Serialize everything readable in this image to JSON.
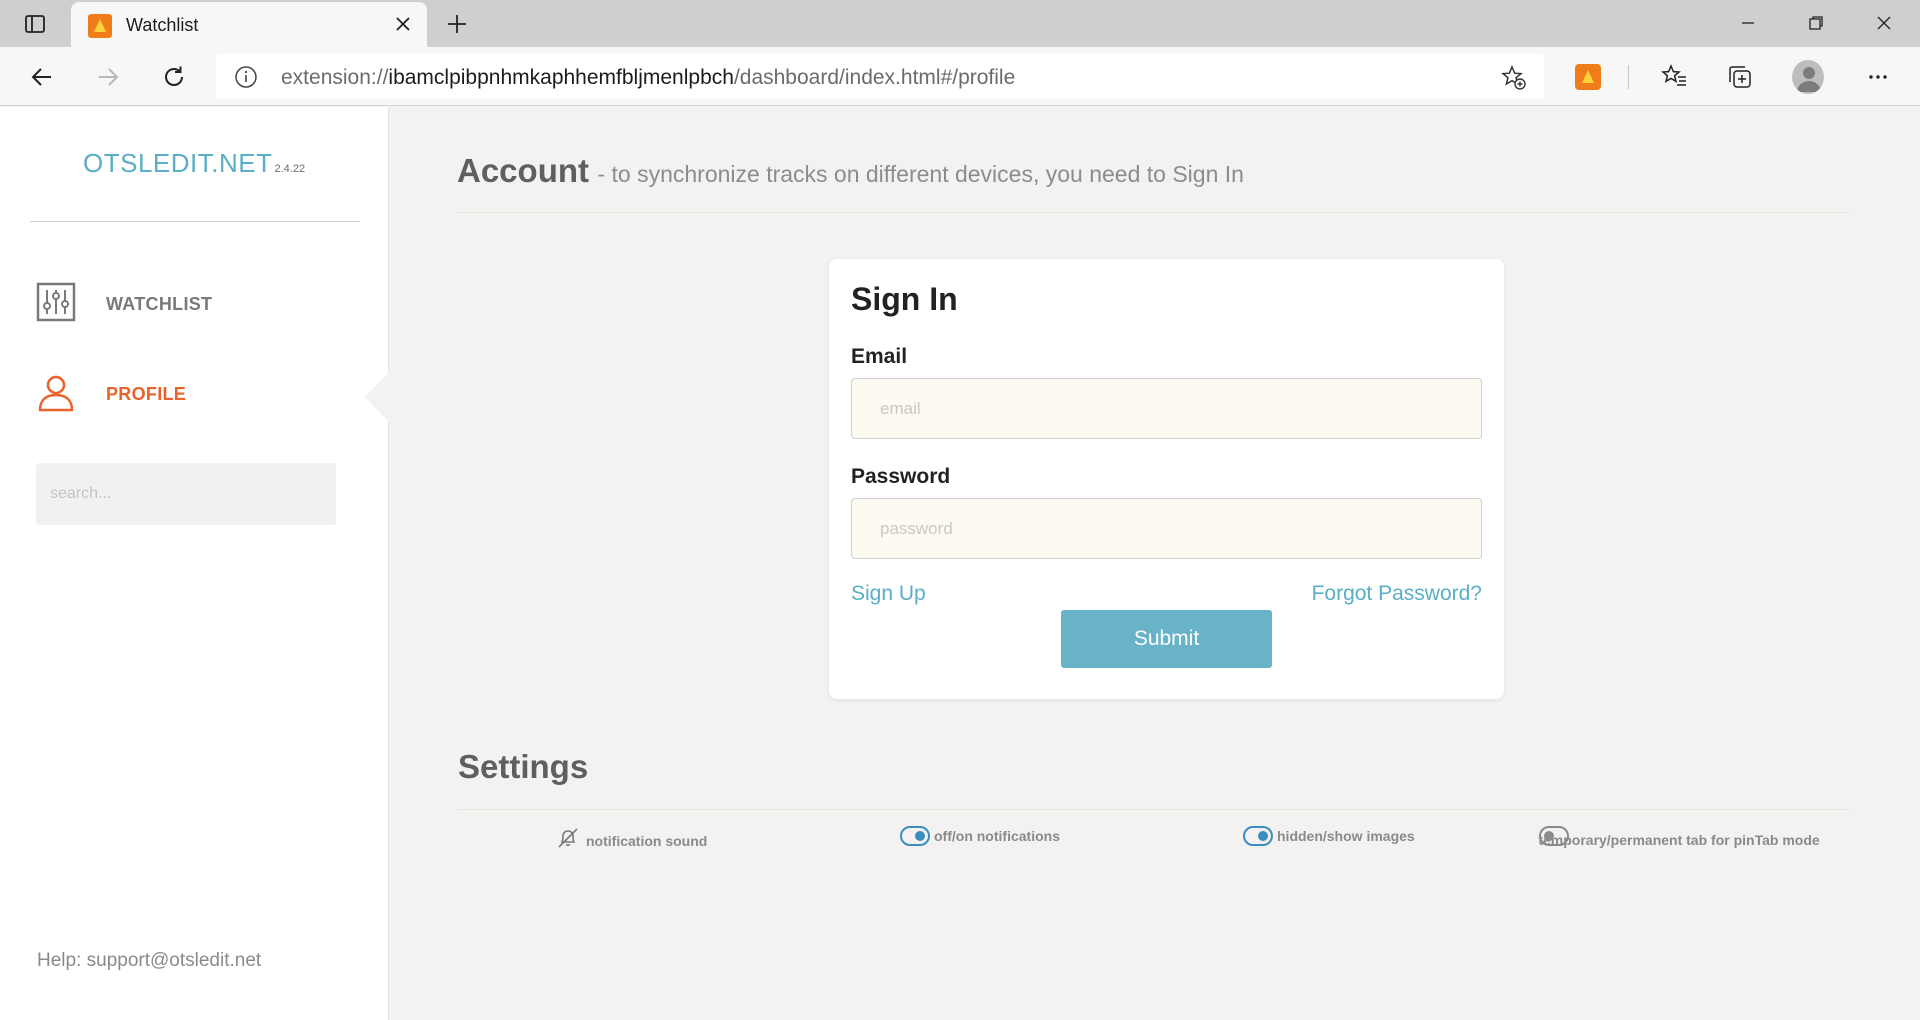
{
  "browser": {
    "tab_title": "Watchlist",
    "url_scheme": "extension://",
    "url_host": "ibamclpibpnhmkaphhemfbljmenlpbch",
    "url_path": "/dashboard/index.html#/profile"
  },
  "sidebar": {
    "logo": "OTSLEDIT.NET",
    "version": "2.4.22",
    "items": [
      {
        "label": "WATCHLIST",
        "icon": "sliders-icon"
      },
      {
        "label": "PROFILE",
        "icon": "user-icon",
        "active": true
      }
    ],
    "search_placeholder": "search...",
    "help": "Help: support@otsledit.net"
  },
  "account": {
    "title": "Account",
    "subtitle": "- to synchronize tracks on different devices, you need to Sign In"
  },
  "signin": {
    "heading": "Sign In",
    "email_label": "Email",
    "email_placeholder": "email",
    "password_label": "Password",
    "password_placeholder": "password",
    "signup_link": "Sign Up",
    "forgot_link": "Forgot Password?",
    "submit_label": "Submit"
  },
  "settings": {
    "title": "Settings",
    "items": [
      {
        "label": "notification sound",
        "control": "muted-bell-icon"
      },
      {
        "label": "off/on notifications",
        "state": "on"
      },
      {
        "label": "hidden/show images",
        "state": "on"
      },
      {
        "label": "temporary/permanent tab for pinTab mode",
        "state": "off"
      }
    ]
  },
  "colors": {
    "accent": "#5aaec5",
    "active": "#e8622a",
    "submit": "#68b3c8",
    "toggle_on": "#3a8dc0"
  }
}
